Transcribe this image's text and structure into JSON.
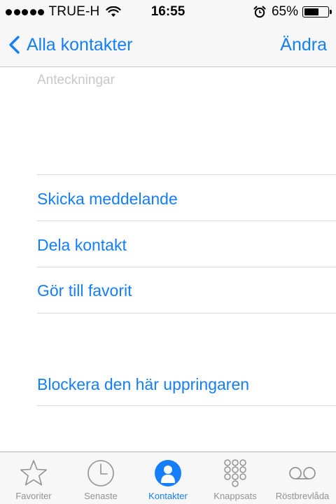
{
  "status_bar": {
    "carrier": "TRUE-H",
    "time": "16:55",
    "battery_percent": "65%",
    "battery_level": 0.65
  },
  "nav": {
    "back_label": "Alla kontakter",
    "edit_label": "Ändra"
  },
  "notes": {
    "placeholder": "Anteckningar"
  },
  "actions": {
    "send_message": "Skicka meddelande",
    "share_contact": "Dela kontakt",
    "add_favorite": "Gör till favorit",
    "block_caller": "Blockera den här uppringaren"
  },
  "tabs": [
    {
      "label": "Favoriter",
      "icon": "star-icon",
      "active": false
    },
    {
      "label": "Senaste",
      "icon": "clock-icon",
      "active": false
    },
    {
      "label": "Kontakter",
      "icon": "contacts-icon",
      "active": true
    },
    {
      "label": "Knappsats",
      "icon": "keypad-icon",
      "active": false
    },
    {
      "label": "Röstbrevlåda",
      "icon": "voicemail-icon",
      "active": false
    }
  ],
  "colors": {
    "accent": "#147efb",
    "inactive": "#929292",
    "placeholder": "#c7c7cc"
  }
}
